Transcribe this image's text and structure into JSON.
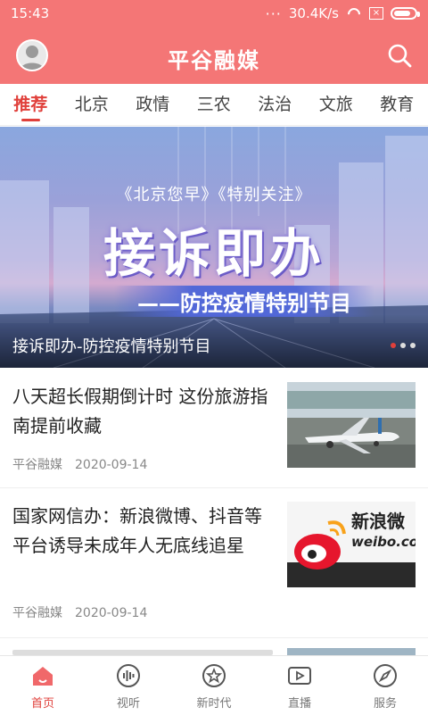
{
  "status": {
    "time": "15:43",
    "speed": "30.4K/s"
  },
  "header": {
    "title": "平谷融媒"
  },
  "tabs": [
    "推荐",
    "北京",
    "政情",
    "三农",
    "法治",
    "文旅",
    "教育"
  ],
  "banner": {
    "subtitle": "《北京您早》《特别关注》",
    "headline": "接诉即办",
    "strap": "——防控疫情特别节目",
    "caption": "接诉即办-防控疫情特别节目",
    "page_indicator": {
      "current": 1,
      "total": 3
    }
  },
  "articles": [
    {
      "title": "八天超长假期倒计时 这份旅游指南提前收藏",
      "source": "平谷融媒",
      "date": "2020-09-14",
      "thumb": "airplane-photo"
    },
    {
      "title": "国家网信办：新浪微博、抖音等平台诱导未成年人无底线追星",
      "source": "平谷融媒",
      "date": "2020-09-14",
      "thumb": "weibo-logo",
      "thumb_text": "新浪微",
      "thumb_url_text": "weibo.co"
    }
  ],
  "tabbar": [
    {
      "label": "首页",
      "icon": "home-icon",
      "active": true
    },
    {
      "label": "视听",
      "icon": "audio-icon"
    },
    {
      "label": "新时代",
      "icon": "star-badge-icon"
    },
    {
      "label": "直播",
      "icon": "live-video-icon"
    },
    {
      "label": "服务",
      "icon": "compass-icon"
    }
  ],
  "colors": {
    "brand": "#f47676",
    "accent": "#e0403b"
  }
}
